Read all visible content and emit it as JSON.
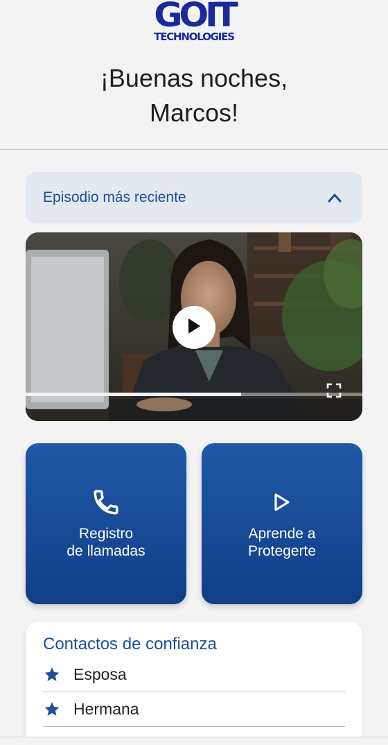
{
  "brand": {
    "logo_mark": "GOIT",
    "logo_sub": "TECHNOLOGIES",
    "color": "#1a2a9c"
  },
  "greeting": {
    "line1": "¡Buenas noches,",
    "line2": "Marcos!"
  },
  "episode": {
    "label": "Episodio más reciente",
    "expanded": true,
    "toggle_icon": "chevron-up-icon"
  },
  "video": {
    "progress": 0.64,
    "play_icon": "play-icon",
    "fullscreen_icon": "fullscreen-icon"
  },
  "tiles": [
    {
      "label_line1": "Registro",
      "label_line2": "de llamadas",
      "icon": "phone-icon"
    },
    {
      "label_line1": "Aprende a",
      "label_line2": "Protegerte",
      "icon": "play-outline-icon"
    }
  ],
  "contacts": {
    "title": "Contactos de confianza",
    "items": [
      {
        "name": "Esposa",
        "icon": "star-icon"
      },
      {
        "name": "Hermana",
        "icon": "star-icon"
      }
    ]
  },
  "colors": {
    "accent": "#1b4f97",
    "tile_top": "#1f58a6",
    "tile_bottom": "#0f3f8a",
    "background": "#f3f3f3"
  }
}
